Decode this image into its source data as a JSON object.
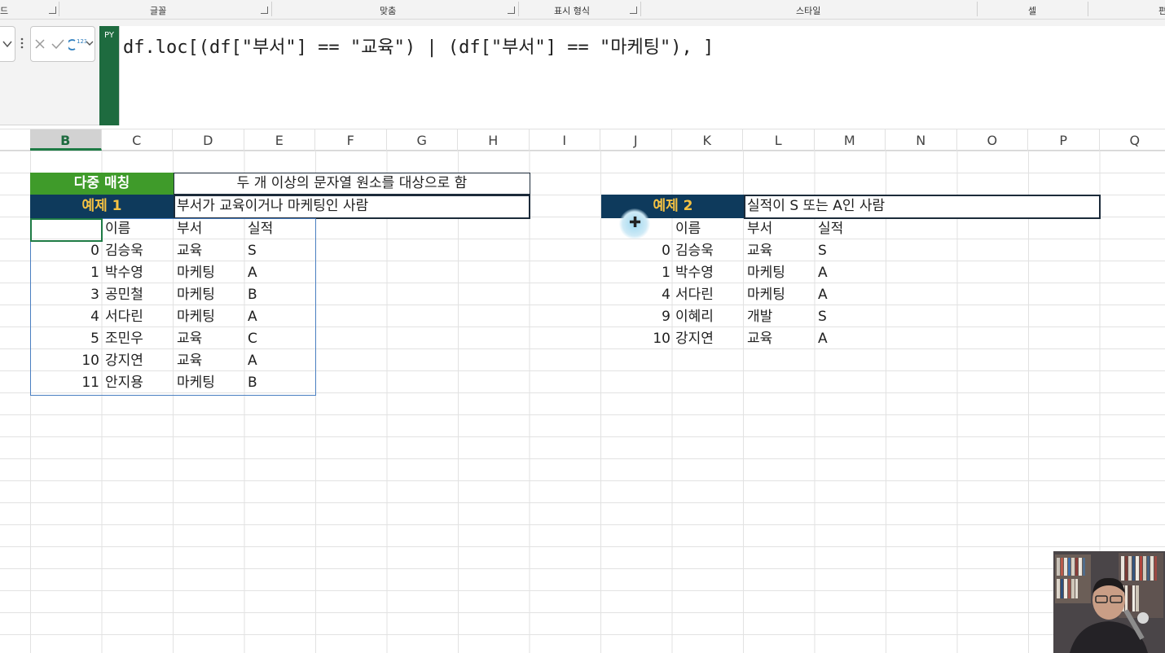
{
  "ribbon": {
    "groups": [
      "드",
      "글꼴",
      "맞춤",
      "표시 형식",
      "스타일",
      "셀",
      "편"
    ]
  },
  "formula_bar": {
    "py_badge": "PY",
    "formula": "df.loc[(df[\"부서\"] == \"교육\") | (df[\"부서\"] == \"마케팅\"), ]"
  },
  "columns": [
    "B",
    "C",
    "D",
    "E",
    "F",
    "G",
    "H",
    "I",
    "J",
    "K",
    "L",
    "M",
    "N",
    "O",
    "P",
    "Q"
  ],
  "selected_column": "B",
  "sheet": {
    "title_label": "다중 매칭",
    "title_desc": "두 개 이상의 문자열 원소를 대상으로 함",
    "example1": {
      "label": "예제 1",
      "desc": "부서가 교육이거나 마케팅인 사람",
      "headers": [
        "이름",
        "부서",
        "실적"
      ],
      "rows": [
        {
          "idx": "0",
          "name": "김승욱",
          "dept": "교육",
          "perf": "S"
        },
        {
          "idx": "1",
          "name": "박수영",
          "dept": "마케팅",
          "perf": "A"
        },
        {
          "idx": "3",
          "name": "공민철",
          "dept": "마케팅",
          "perf": "B"
        },
        {
          "idx": "4",
          "name": "서다린",
          "dept": "마케팅",
          "perf": "A"
        },
        {
          "idx": "5",
          "name": "조민우",
          "dept": "교육",
          "perf": "C"
        },
        {
          "idx": "10",
          "name": "강지연",
          "dept": "교육",
          "perf": "A"
        },
        {
          "idx": "11",
          "name": "안지용",
          "dept": "마케팅",
          "perf": "B"
        }
      ]
    },
    "example2": {
      "label": "예제 2",
      "desc": "실적이 S 또는 A인 사람",
      "headers": [
        "이름",
        "부서",
        "실적"
      ],
      "rows": [
        {
          "idx": "0",
          "name": "김승욱",
          "dept": "교육",
          "perf": "S"
        },
        {
          "idx": "1",
          "name": "박수영",
          "dept": "마케팅",
          "perf": "A"
        },
        {
          "idx": "4",
          "name": "서다린",
          "dept": "마케팅",
          "perf": "A"
        },
        {
          "idx": "9",
          "name": "이혜리",
          "dept": "개발",
          "perf": "S"
        },
        {
          "idx": "10",
          "name": "강지연",
          "dept": "교육",
          "perf": "A"
        }
      ]
    }
  },
  "colors": {
    "green_header": "#3f9b2a",
    "navy_header": "#0e3a5c",
    "navy_text": "#f5c242",
    "excel_green": "#1e6b3f"
  }
}
